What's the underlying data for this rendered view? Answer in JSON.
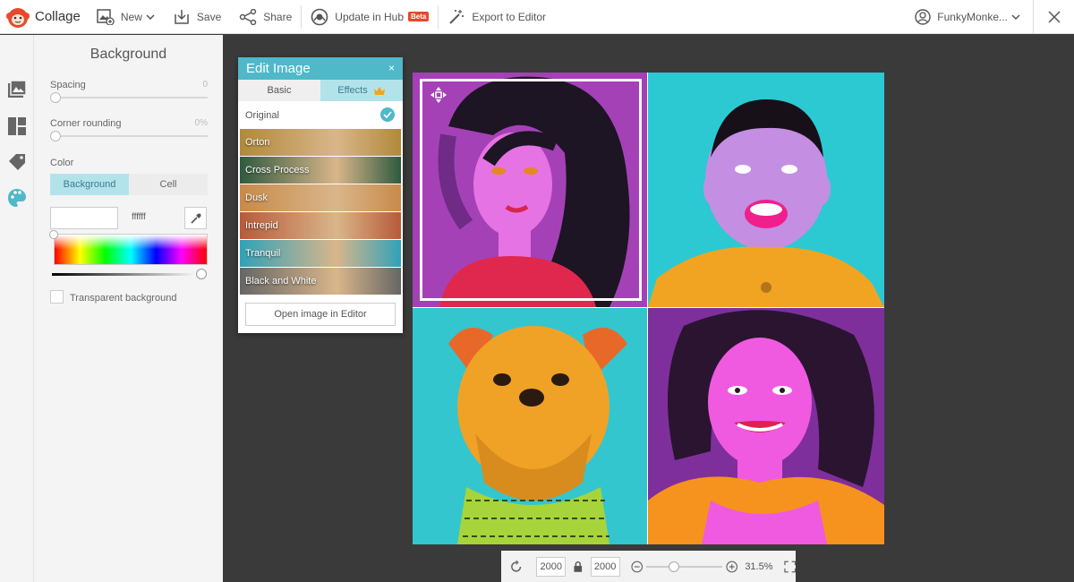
{
  "app": {
    "name": "Collage",
    "accent": "#4fb8c9",
    "brand_color": "#e8482b"
  },
  "toolbar": {
    "new_label": "New",
    "save_label": "Save",
    "share_label": "Share",
    "update_label": "Update in Hub",
    "beta_badge": "Beta",
    "export_label": "Export to Editor",
    "user_name": "FunkyMonke..."
  },
  "rail": [
    "photos-icon",
    "layouts-icon",
    "stickers-icon",
    "background-icon"
  ],
  "background_panel": {
    "title": "Background",
    "spacing_label": "Spacing",
    "spacing_value": "0",
    "corner_label": "Corner rounding",
    "corner_value": "0%",
    "color_label": "Color",
    "tabs": [
      "Background",
      "Cell"
    ],
    "hex_value": "ffffff",
    "transparent_label": "Transparent background"
  },
  "edit_image": {
    "title": "Edit Image",
    "close": "×",
    "tabs": [
      "Basic",
      "Effects"
    ],
    "original_label": "Original",
    "effects": [
      "Orton",
      "Cross Process",
      "Dusk",
      "Intrepid",
      "Tranquil",
      "Black and White"
    ],
    "effect_colors": [
      "#b08a3a",
      "#2f5a3f",
      "#c88a4a",
      "#b85a3a",
      "#2fa2b8",
      "#666666"
    ],
    "open_editor_label": "Open image in Editor"
  },
  "collage": {
    "cells": [
      {
        "bg": "#a541b7",
        "subject": "woman-curly-hair"
      },
      {
        "bg": "#2cc9d3",
        "subject": "laughing-child"
      },
      {
        "bg": "#33c6cf",
        "subject": "dog-sweater"
      },
      {
        "bg": "#7f2f9c",
        "subject": "smiling-woman"
      }
    ]
  },
  "bottombar": {
    "width": "2000",
    "height": "2000",
    "zoom": "31.5%",
    "zoom_level": 0.35
  }
}
